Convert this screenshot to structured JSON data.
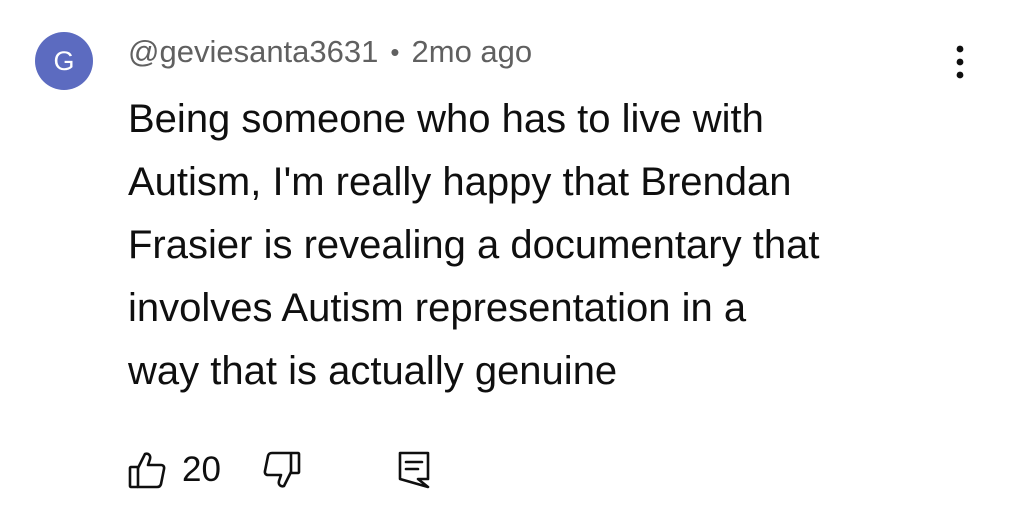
{
  "comment": {
    "avatar_letter": "G",
    "avatar_color": "#5c6bc0",
    "author": "@geviesanta3631",
    "separator": "•",
    "timestamp": "2mo ago",
    "lines": [
      "Being someone who has to live with",
      "Autism, I'm really happy that Brendan",
      "Frasier is revealing a documentary that",
      "involves Autism representation in a",
      "way that is actually genuine"
    ],
    "like_count": "20"
  },
  "icons": {
    "menu": "more-vertical-icon",
    "like": "thumbs-up-icon",
    "dislike": "thumbs-down-icon",
    "reply": "reply-comment-icon"
  }
}
